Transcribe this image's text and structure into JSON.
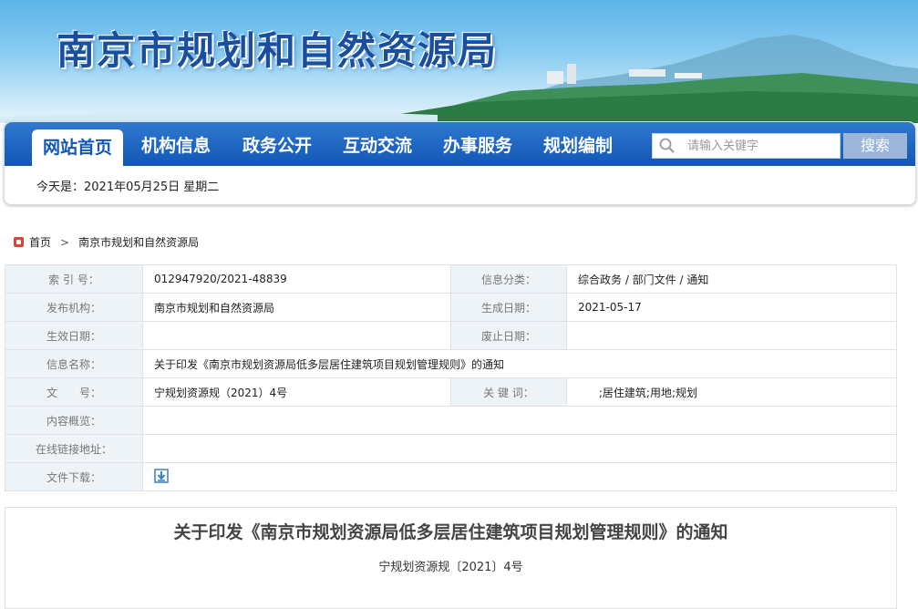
{
  "banner": {
    "title": "南京市规划和自然资源局"
  },
  "nav": {
    "items": [
      "网站首页",
      "机构信息",
      "政务公开",
      "互动交流",
      "办事服务",
      "规划编制"
    ],
    "active_index": 0,
    "search_placeholder": "请输入关键字",
    "search_button": "搜索"
  },
  "today": "今天是：2021年05月25日  星期二",
  "breadcrumb": {
    "home": "首页",
    "current": "南京市规划和自然资源局"
  },
  "meta": {
    "index_label": "索 引 号：",
    "index_value": "012947920/2021-48839",
    "category_label": "信息分类：",
    "category_value": "综合政务 / 部门文件 / 通知",
    "publisher_label": "发布机构：",
    "publisher_value": "南京市规划和自然资源局",
    "created_label": "生成日期：",
    "created_value": "2021-05-17",
    "effective_label": "生效日期：",
    "effective_value": "",
    "abolished_label": "废止日期：",
    "abolished_value": "",
    "name_label": "信息名称：",
    "name_value": "关于印发《南京市规划资源局低多层居住建筑项目规划管理规则》的通知",
    "docno_label": "文　　号：",
    "docno_value": "宁规划资源规（2021）4号",
    "keywords_label": "关 键 词：",
    "keywords_value": "      ;居住建筑;用地;规划",
    "overview_label": "内容概览：",
    "overview_value": "",
    "link_label": "在线链接地址：",
    "link_value": "",
    "download_label": "文件下载：",
    "download_icon": "download-icon"
  },
  "article": {
    "title": "关于印发《南京市规划资源局低多层居住建筑项目规划管理规则》的通知",
    "doc_no": "宁规划资源规〔2021〕4号"
  }
}
